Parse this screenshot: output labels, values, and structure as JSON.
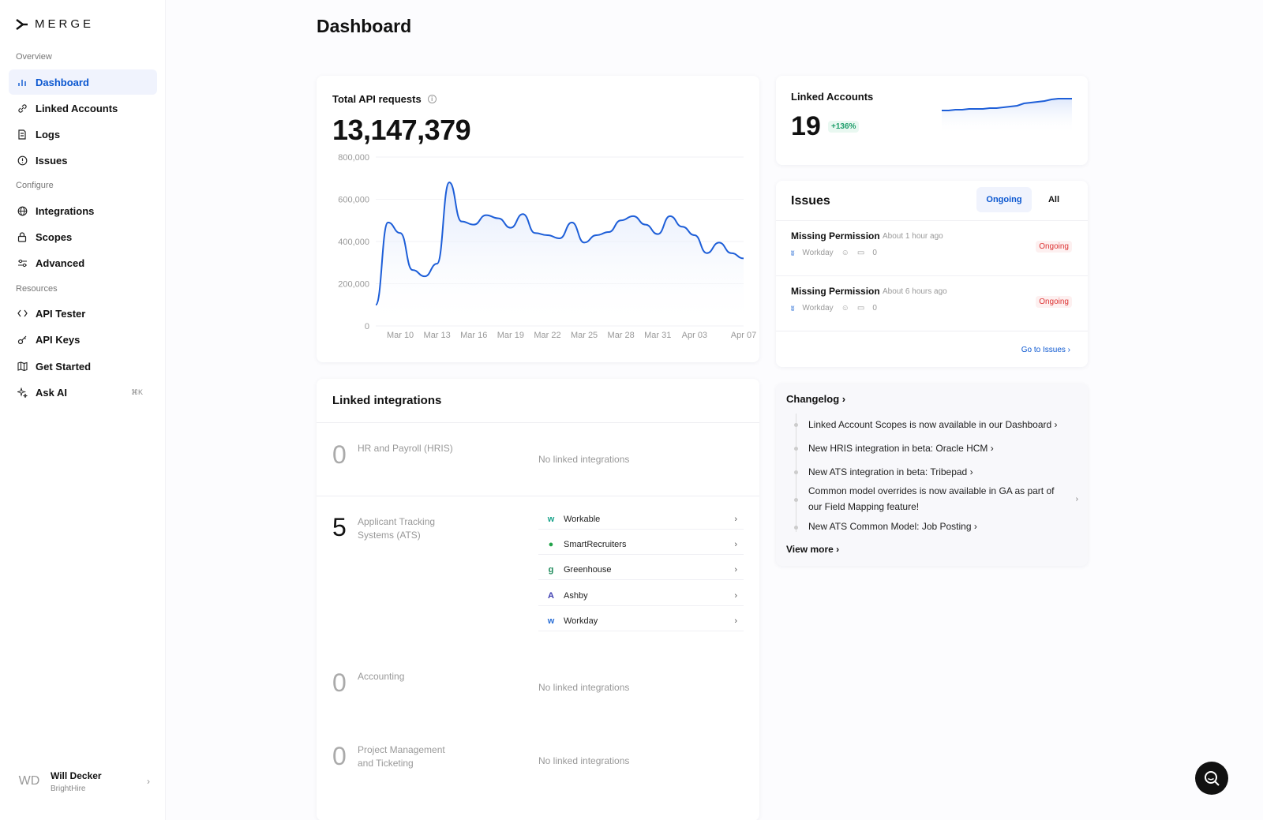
{
  "logo": {
    "text": "MERGE"
  },
  "sidebar": {
    "sections": {
      "overview": "Overview",
      "configure": "Configure",
      "resources": "Resources"
    },
    "items": [
      {
        "label": "Dashboard",
        "icon": "bar-chart-icon"
      },
      {
        "label": "Linked Accounts",
        "icon": "link-icon"
      },
      {
        "label": "Logs",
        "icon": "logs-icon"
      },
      {
        "label": "Issues",
        "icon": "alert-circle-icon"
      },
      {
        "label": "Integrations",
        "icon": "globe-icon"
      },
      {
        "label": "Scopes",
        "icon": "lock-icon"
      },
      {
        "label": "Advanced",
        "icon": "sliders-icon"
      },
      {
        "label": "API Tester",
        "icon": "code-icon"
      },
      {
        "label": "API Keys",
        "icon": "key-icon"
      },
      {
        "label": "Get Started",
        "icon": "map-icon"
      },
      {
        "label": "Ask AI",
        "icon": "sparkle-icon",
        "shortcut": "⌘K"
      }
    ],
    "user": {
      "initials": "WD",
      "name": "Will Decker",
      "org": "BrightHire"
    }
  },
  "page_title": "Dashboard",
  "api_card": {
    "title": "Total API requests",
    "value": "13,147,379"
  },
  "chart_data": {
    "type": "area",
    "title": "",
    "xlabel": "",
    "ylabel": "",
    "ylim": [
      0,
      800000
    ],
    "y_ticks": [
      "800,000",
      "600,000",
      "400,000",
      "200,000",
      "0"
    ],
    "x_ticks": [
      "Mar 10",
      "Mar 13",
      "Mar 16",
      "Mar 19",
      "Mar 22",
      "Mar 25",
      "Mar 28",
      "Mar 31",
      "Apr 03",
      "Apr 07"
    ],
    "x": [
      "Mar 08",
      "Mar 09",
      "Mar 10",
      "Mar 11",
      "Mar 12",
      "Mar 13",
      "Mar 14",
      "Mar 15",
      "Mar 16",
      "Mar 17",
      "Mar 18",
      "Mar 19",
      "Mar 20",
      "Mar 21",
      "Mar 22",
      "Mar 23",
      "Mar 24",
      "Mar 25",
      "Mar 26",
      "Mar 27",
      "Mar 28",
      "Mar 29",
      "Mar 30",
      "Mar 31",
      "Apr 01",
      "Apr 02",
      "Apr 03",
      "Apr 04",
      "Apr 05",
      "Apr 06",
      "Apr 07"
    ],
    "values": [
      100000,
      490000,
      440000,
      265000,
      235000,
      295000,
      680000,
      495000,
      480000,
      525000,
      510000,
      465000,
      530000,
      440000,
      430000,
      415000,
      490000,
      395000,
      430000,
      445000,
      500000,
      520000,
      480000,
      435000,
      520000,
      470000,
      430000,
      345000,
      395000,
      345000,
      320000
    ],
    "grid": true,
    "color": "#1d5ed8"
  },
  "linked_accounts": {
    "title": "Linked Accounts",
    "value": "19",
    "change": "+136%",
    "trend": [
      4,
      4,
      5,
      5,
      6,
      6,
      6,
      7,
      7,
      8,
      9,
      10,
      13,
      14,
      15,
      16,
      18,
      19,
      19,
      19
    ]
  },
  "issues": {
    "title": "Issues",
    "tabs": {
      "ongoing": "Ongoing",
      "all": "All"
    },
    "rows": [
      {
        "name": "Missing Permission",
        "time": "About 1 hour ago",
        "integration": "Workday",
        "comments": "0",
        "status": "Ongoing"
      },
      {
        "name": "Missing Permission",
        "time": "About 6 hours ago",
        "integration": "Workday",
        "comments": "0",
        "status": "Ongoing"
      }
    ],
    "link": "Go to Issues ›"
  },
  "linked_integrations": {
    "title": "Linked integrations",
    "categories": [
      {
        "count": "0",
        "name": "HR and Payroll (HRIS)",
        "empty": "No linked integrations"
      },
      {
        "count": "5",
        "name": "Applicant Tracking Systems (ATS)",
        "items": [
          "Workable",
          "SmartRecruiters",
          "Greenhouse",
          "Ashby",
          "Workday"
        ]
      },
      {
        "count": "0",
        "name": "Accounting",
        "empty": "No linked integrations"
      },
      {
        "count": "0",
        "name": "Project Management and Ticketing",
        "empty": "No linked integrations"
      }
    ]
  },
  "changelog": {
    "title": "Changelog ›",
    "items": [
      "Linked Account Scopes is now available in our Dashboard ›",
      "New HRIS integration in beta: Oracle HCM ›",
      "New ATS integration in beta: Tribepad ›",
      "Common model overrides is now available in GA as part of our Field Mapping feature!",
      "New ATS Common Model: Job Posting ›"
    ],
    "more": "View more ›"
  }
}
